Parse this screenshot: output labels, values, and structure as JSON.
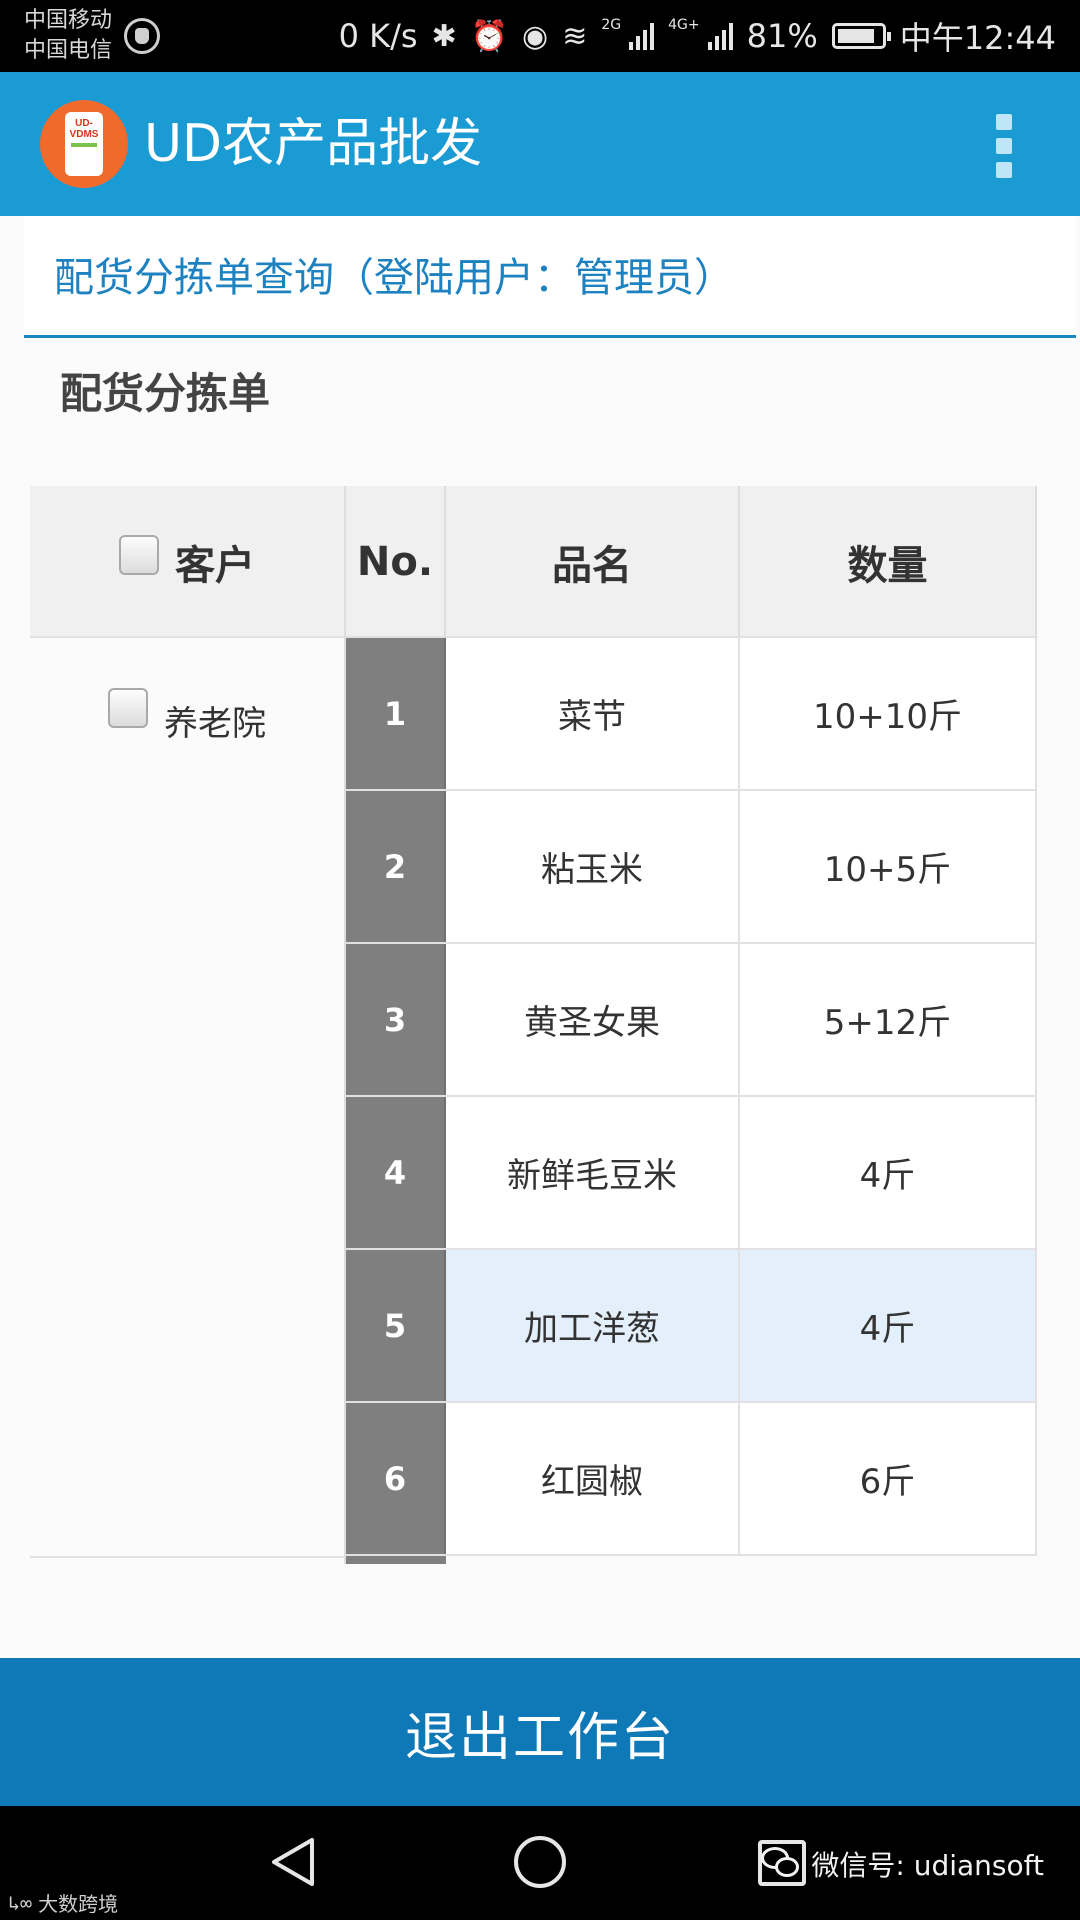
{
  "status_bar": {
    "carrier_1": "中国移动",
    "carrier_2": "中国电信",
    "speed": "0 K/s",
    "net_2g": "2G",
    "net_4g": "4G+",
    "battery": "81%",
    "time": "中午12:44"
  },
  "app_bar": {
    "logo_text_1": "UD-",
    "logo_text_2": "VDMS",
    "title": "UD农产品批发"
  },
  "page": {
    "header": "配货分拣单查询（登陆用户：管理员）",
    "section_title": "配货分拣单"
  },
  "table": {
    "columns": [
      "客户",
      "No.",
      "品名",
      "数量"
    ],
    "customer": "养老院",
    "rows": [
      {
        "no": "1",
        "name": "菜节",
        "qty": "10+10斤"
      },
      {
        "no": "2",
        "name": "粘玉米",
        "qty": "10+5斤"
      },
      {
        "no": "3",
        "name": "黄圣女果",
        "qty": "5+12斤"
      },
      {
        "no": "4",
        "name": "新鲜毛豆米",
        "qty": "4斤"
      },
      {
        "no": "5",
        "name": "加工洋葱",
        "qty": "4斤"
      },
      {
        "no": "6",
        "name": "红圆椒",
        "qty": "6斤"
      }
    ]
  },
  "exit_button": "退出工作台",
  "watermarks": {
    "wechat": "微信号: udiansoft",
    "left": "大数跨境"
  },
  "colors": {
    "app_bar": "#1a9bd3",
    "header_text": "#1f82c0",
    "exit_button": "#0f79b8",
    "row_highlight": "#e3effa",
    "number_cell": "#7f7f7f"
  }
}
